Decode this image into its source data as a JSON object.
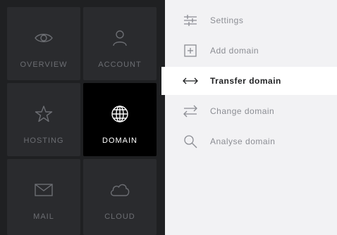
{
  "tiles": [
    {
      "label": "OVERVIEW",
      "icon": "eye-icon"
    },
    {
      "label": "ACCOUNT",
      "icon": "user-icon"
    },
    {
      "label": "HOSTING",
      "icon": "star-icon"
    },
    {
      "label": "DOMAIN",
      "icon": "globe-icon",
      "active": true
    },
    {
      "label": "MAIL",
      "icon": "envelope-icon"
    },
    {
      "label": "CLOUD",
      "icon": "cloud-icon"
    }
  ],
  "menu": [
    {
      "label": "Settings",
      "icon": "sliders-icon"
    },
    {
      "label": "Add domain",
      "icon": "plus-box-icon"
    },
    {
      "label": "Transfer domain",
      "icon": "double-arrow-icon",
      "active": true
    },
    {
      "label": "Change domain",
      "icon": "swap-arrows-icon"
    },
    {
      "label": "Analyse domain",
      "icon": "search-icon"
    }
  ],
  "colors": {
    "panel_bg": "#1f2022",
    "tile_bg": "#2a2b2e",
    "tile_active_bg": "#000000",
    "menu_bg": "#f2f2f4",
    "menu_active_bg": "#ffffff"
  }
}
